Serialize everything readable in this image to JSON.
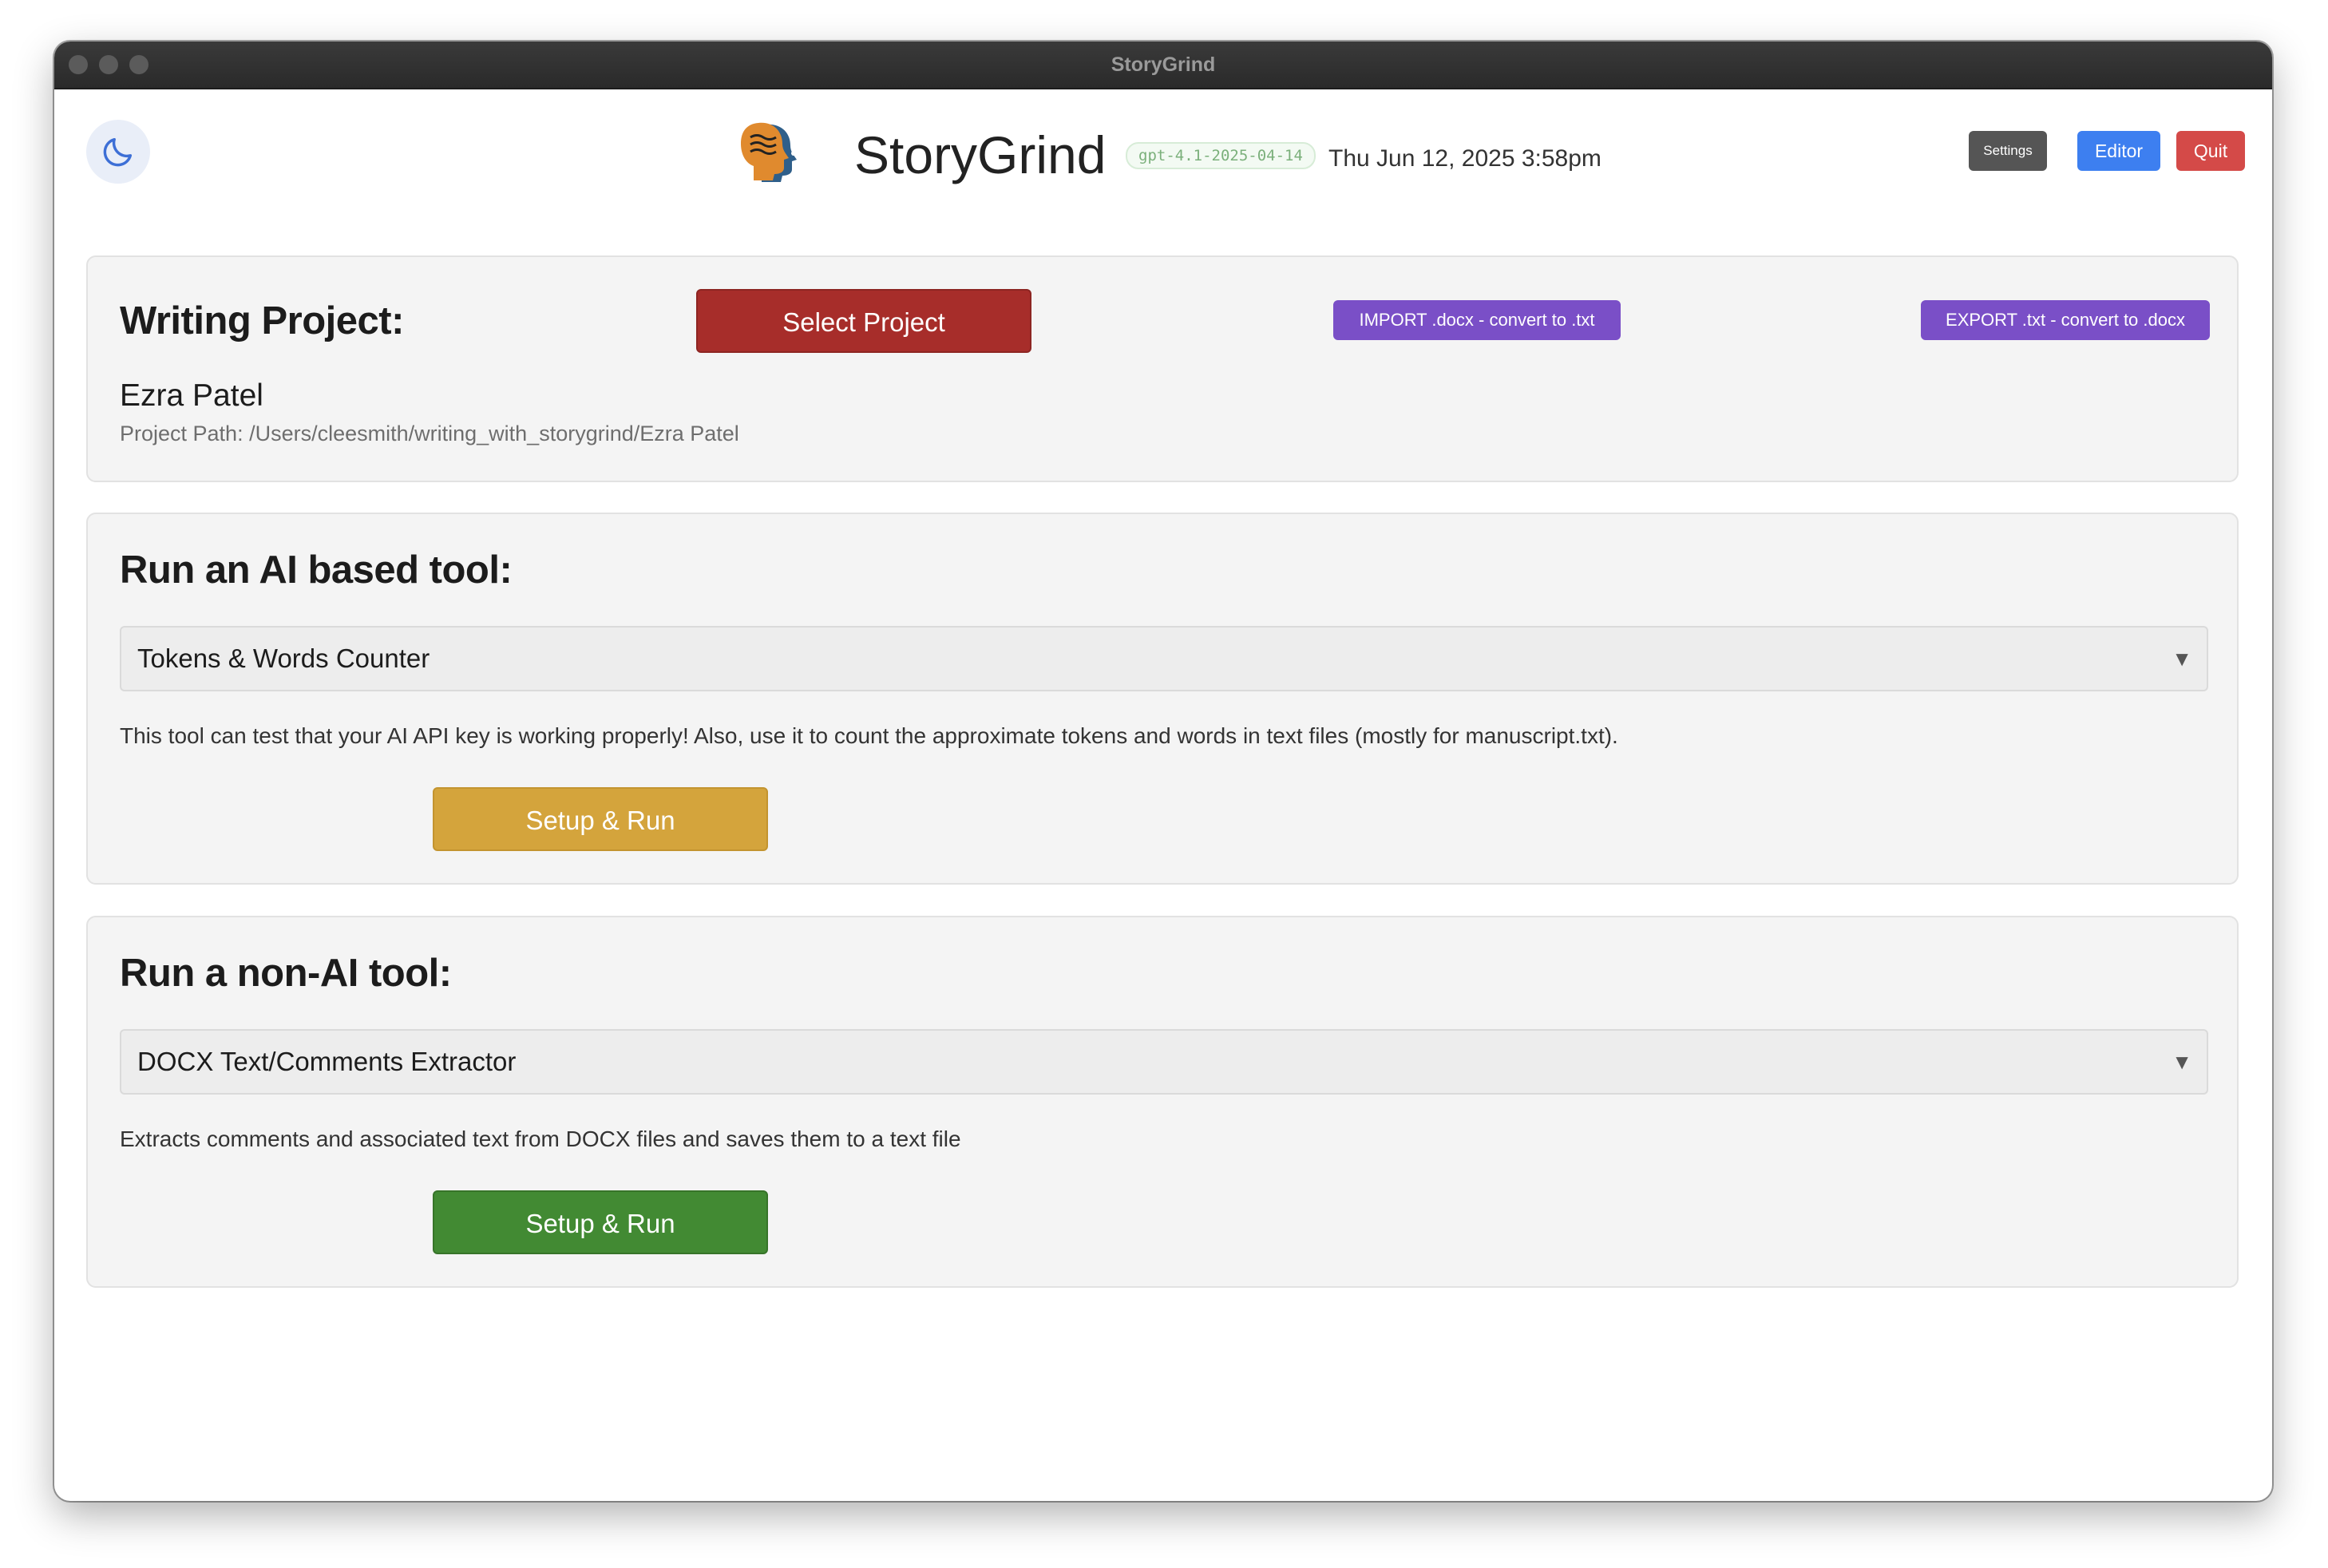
{
  "window": {
    "title": "StoryGrind"
  },
  "header": {
    "theme_icon": "moon-icon",
    "logo_icon": "profile-heads-icon",
    "app_name": "StoryGrind",
    "model": "gpt-4.1-2025-04-14",
    "datetime": "Thu Jun 12, 2025 3:58pm",
    "settings_label": "Settings",
    "editor_label": "Editor",
    "quit_label": "Quit"
  },
  "project": {
    "heading": "Writing Project:",
    "select_label": "Select Project",
    "import_label": "IMPORT .docx - convert to .txt",
    "export_label": "EXPORT .txt - convert to .docx",
    "name": "Ezra Patel",
    "path": "Project Path: /Users/cleesmith/writing_with_storygrind/Ezra Patel"
  },
  "ai_tool": {
    "heading": "Run an AI based tool:",
    "selected": "Tokens & Words Counter",
    "description": "This tool can test that your AI API key is working properly! Also, use it to count the approximate tokens and words in text files (mostly for manuscript.txt).",
    "run_label": "Setup & Run"
  },
  "non_ai_tool": {
    "heading": "Run a non-AI tool:",
    "selected": "DOCX Text/Comments Extractor",
    "description": "Extracts comments and associated text from DOCX files and saves them to a text file",
    "run_label": "Setup & Run"
  },
  "colors": {
    "select_project": "#a72d2a",
    "purple": "#7a4fc7",
    "editor": "#3d7ff0",
    "quit": "#d44a48",
    "settings": "#555555",
    "run_ai": "#d4a43c",
    "run_non_ai": "#428a33"
  }
}
